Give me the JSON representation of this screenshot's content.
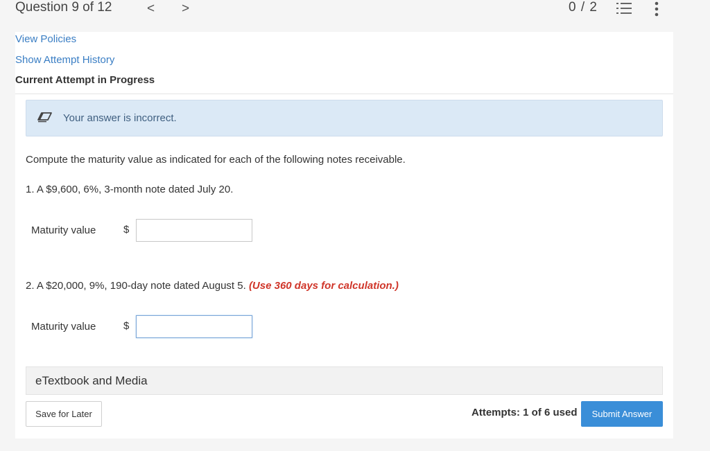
{
  "header": {
    "question_label": "Question 9 of 12",
    "prev_icon": "chevron-left-icon",
    "next_icon": "chevron-right-icon",
    "score": "0 / 2",
    "list_icon": "numbered-list-icon",
    "more_icon": "more-vertical-icon"
  },
  "links": {
    "view_policies": "View Policies",
    "show_attempt_history": "Show Attempt History"
  },
  "attempt_heading": "Current Attempt in Progress",
  "feedback": {
    "icon": "pencil-eraser-icon",
    "text": "Your answer is incorrect."
  },
  "question": {
    "instruction": "Compute the maturity value as indicated for each of the following notes receivable.",
    "part1": {
      "text": "1. A $9,600, 6%, 3-month note dated July 20.",
      "label": "Maturity value",
      "currency": "$",
      "value": ""
    },
    "part2": {
      "text": "2. A $20,000, 9%, 190-day note dated August 5.",
      "note": "(Use 360 days for calculation.)",
      "label": "Maturity value",
      "currency": "$",
      "value": ""
    }
  },
  "media": {
    "label": "eTextbook and Media"
  },
  "footer": {
    "save_label": "Save for Later",
    "attempts_text": "Attempts: 1 of 6 used",
    "submit_label": "Submit Answer"
  },
  "colors": {
    "link": "#3a7ec4",
    "feedback_bg": "#dbe9f6",
    "note_red": "#d0362a",
    "submit_bg": "#3a8ed8"
  }
}
